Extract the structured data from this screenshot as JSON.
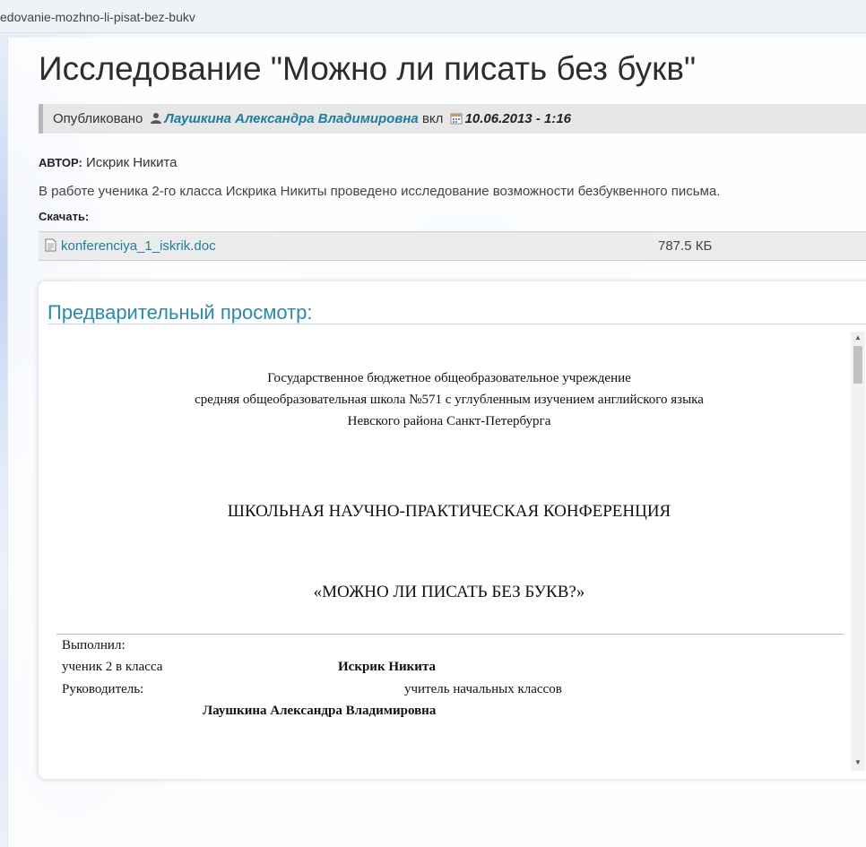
{
  "browser": {
    "url": "edovanie-mozhno-li-pisat-bez-bukv"
  },
  "article": {
    "title": "Исследование \"Можно ли писать без букв\"",
    "meta": {
      "published_label": "Опубликовано",
      "author_name": "Лаушкина Александра Владимировна",
      "in_label": "вкл",
      "date": "10.06.2013 - 1:16"
    },
    "author_label": "АВТОР:",
    "author_value": "Искрик Никита",
    "description": "В работе ученика 2-го класса Искрика Никиты проведено исследование возможности безбуквенного письма.",
    "download_label": "Скачать:",
    "file": {
      "name": "konferenciya_1_iskrik.doc",
      "size": "787.5 КБ"
    }
  },
  "preview": {
    "title": "Предварительный просмотр:",
    "doc": {
      "header_lines": [
        "Государственное бюджетное общеобразовательное учреждение",
        "средняя общеобразовательная школа №571 с углубленным изучением английского языка",
        "Невского района Санкт-Петербурга"
      ],
      "conference": "ШКОЛЬНАЯ НАУЧНО-ПРАКТИЧЕСКАЯ КОНФЕРЕНЦИЯ",
      "topic": "«МОЖНО ЛИ ПИСАТЬ БЕЗ БУКВ?»",
      "done_by_label": "Выполнил:",
      "student_label": "ученик 2 в класса",
      "student_name": "Искрик Никита",
      "supervisor_label": "Руководитель:",
      "supervisor_role": "учитель начальных классов",
      "supervisor_name": "Лаушкина Александра Владимировна"
    }
  }
}
